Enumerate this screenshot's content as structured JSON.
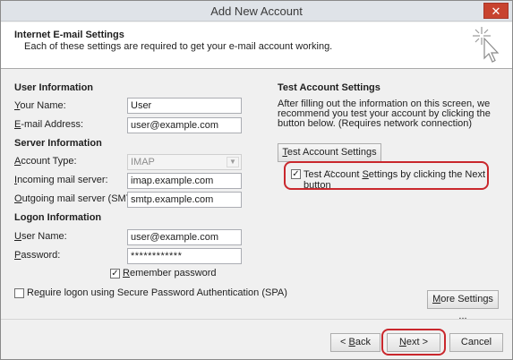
{
  "window": {
    "title": "Add New Account",
    "close_label": "✕"
  },
  "header": {
    "title": "Internet E-mail Settings",
    "subtitle": "Each of these settings are required to get your e-mail account working."
  },
  "user_info": {
    "heading": "User Information",
    "name_label": "Your Name:",
    "name_value": "User",
    "email_label": "E-mail Address:",
    "email_value": "user@example.com"
  },
  "server_info": {
    "heading": "Server Information",
    "account_type_label": "Account Type:",
    "account_type_value": "IMAP",
    "incoming_label": "Incoming mail server:",
    "incoming_value": "imap.example.com",
    "outgoing_label": "Outgoing mail server (SMTP):",
    "outgoing_value": "smtp.example.com"
  },
  "logon_info": {
    "heading": "Logon Information",
    "username_label": "User Name:",
    "username_value": "user@example.com",
    "password_label": "Password:",
    "password_value": "************",
    "remember_label": "Remember password",
    "remember_checked": true,
    "spa_label": "Require logon using Secure Password Authentication (SPA)",
    "spa_checked": false
  },
  "test_settings": {
    "heading": "Test Account Settings",
    "description": "After filling out the information on this screen, we recommend you test your account by clicking the button below. (Requires network connection)",
    "test_button": "Test Account Settings ...",
    "next_checkbox_label": "Test Account Settings by clicking the Next button",
    "next_checkbox_checked": true
  },
  "more_settings_button": "More Settings ...",
  "footer": {
    "back_button": "< Back",
    "next_button": "Next >",
    "cancel_button": "Cancel"
  },
  "colors": {
    "highlight": "#c9272c",
    "close": "#c8432f"
  }
}
